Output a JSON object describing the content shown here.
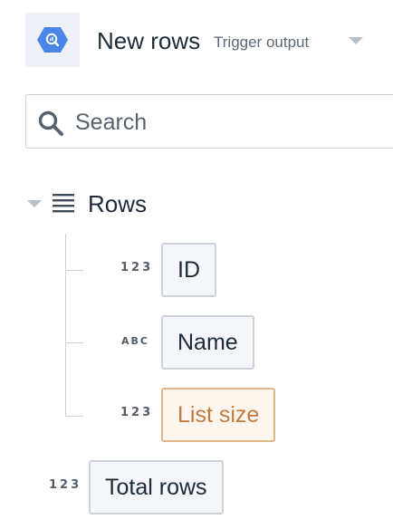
{
  "header": {
    "app_icon": "google-bigquery-icon",
    "title": "New rows",
    "subtitle": "Trigger output",
    "dropdown_icon": "caret-down-icon"
  },
  "search": {
    "placeholder": "Search",
    "value": ""
  },
  "tree": {
    "group": {
      "label": "Rows",
      "toggle_icon": "caret-down-icon",
      "icon": "list-icon",
      "children": [
        {
          "type": "123",
          "label": "ID"
        },
        {
          "type": "ABC",
          "label": "Name"
        },
        {
          "type": "123",
          "label": "List size"
        }
      ]
    },
    "root_item": {
      "type": "123",
      "label": "Total rows"
    }
  },
  "colors": {
    "icon_blue": "#4a86e8",
    "highlight_text": "#c47a3e",
    "highlight_border": "#e2b48a",
    "pill_border": "#cdd3da",
    "pill_bg": "#f4f6f9",
    "tree_line": "#c9d0d8"
  }
}
